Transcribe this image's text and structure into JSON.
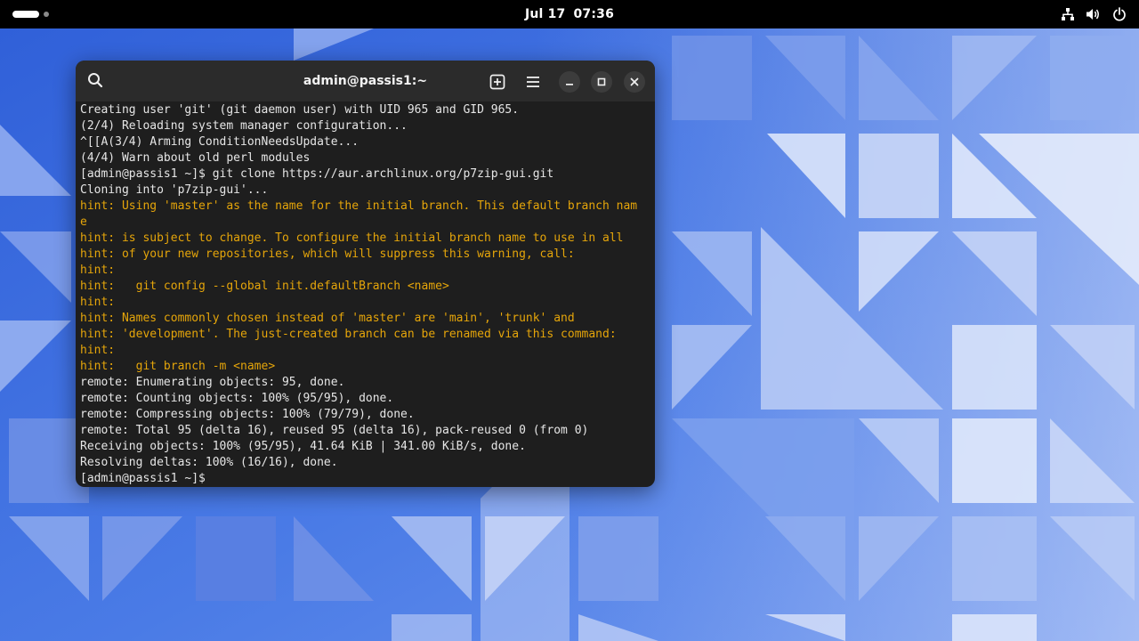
{
  "topbar": {
    "date": "Jul 17",
    "time": "07:36",
    "icons": [
      "network-icon",
      "volume-icon",
      "power-icon"
    ]
  },
  "terminal": {
    "title": "admin@passis1:~",
    "lines": [
      {
        "text": "Creating user 'git' (git daemon user) with UID 965 and GID 965.",
        "hint": false
      },
      {
        "text": "(2/4) Reloading system manager configuration...",
        "hint": false
      },
      {
        "text": "^[[A(3/4) Arming ConditionNeedsUpdate...",
        "hint": false
      },
      {
        "text": "(4/4) Warn about old perl modules",
        "hint": false
      },
      {
        "text": "[admin@passis1 ~]$ git clone https://aur.archlinux.org/p7zip-gui.git",
        "hint": false
      },
      {
        "text": "Cloning into 'p7zip-gui'...",
        "hint": false
      },
      {
        "text": "hint: Using 'master' as the name for the initial branch. This default branch nam",
        "hint": true
      },
      {
        "text": "e",
        "hint": true
      },
      {
        "text": "hint: is subject to change. To configure the initial branch name to use in all",
        "hint": true
      },
      {
        "text": "hint: of your new repositories, which will suppress this warning, call:",
        "hint": true
      },
      {
        "text": "hint:",
        "hint": true
      },
      {
        "text": "hint:   git config --global init.defaultBranch <name>",
        "hint": true
      },
      {
        "text": "hint:",
        "hint": true
      },
      {
        "text": "hint: Names commonly chosen instead of 'master' are 'main', 'trunk' and",
        "hint": true
      },
      {
        "text": "hint: 'development'. The just-created branch can be renamed via this command:",
        "hint": true
      },
      {
        "text": "hint:",
        "hint": true
      },
      {
        "text": "hint:   git branch -m <name>",
        "hint": true
      },
      {
        "text": "remote: Enumerating objects: 95, done.",
        "hint": false
      },
      {
        "text": "remote: Counting objects: 100% (95/95), done.",
        "hint": false
      },
      {
        "text": "remote: Compressing objects: 100% (79/79), done.",
        "hint": false
      },
      {
        "text": "remote: Total 95 (delta 16), reused 95 (delta 16), pack-reused 0 (from 0)",
        "hint": false
      },
      {
        "text": "Receiving objects: 100% (95/95), 41.64 KiB | 341.00 KiB/s, done.",
        "hint": false
      },
      {
        "text": "Resolving deltas: 100% (16/16), done.",
        "hint": false
      },
      {
        "text": "[admin@passis1 ~]$ ",
        "hint": false
      }
    ]
  },
  "colors": {
    "hint": "#e5a50a",
    "text": "#e6e6e6",
    "terminal_bg": "#1e1e1e",
    "headerbar_bg": "#2b2b2b",
    "wallpaper_base": "#3d6fe0"
  }
}
